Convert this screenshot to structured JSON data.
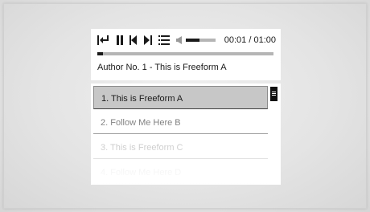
{
  "player": {
    "time_current": "00:01",
    "time_separator": " / ",
    "time_total": "01:00",
    "progress": 0.03,
    "volume": 0.45,
    "now_playing": "Author No. 1 - This is Freeform A",
    "controls": [
      {
        "name": "restart-icon"
      },
      {
        "name": "pause-icon"
      },
      {
        "name": "previous-track-icon"
      },
      {
        "name": "next-track-icon"
      },
      {
        "name": "playlist-icon"
      },
      {
        "name": "volume-icon"
      }
    ]
  },
  "playlist": {
    "items": [
      {
        "label": "1. This is Freeform A",
        "active": true
      },
      {
        "label": "2. Follow Me Here B",
        "active": false
      },
      {
        "label": "3. This is Freeform C",
        "active": false
      },
      {
        "label": "4. Follow Me Here D",
        "active": false
      }
    ]
  },
  "colors": {
    "background": "#e4e4e4",
    "panel": "#ffffff",
    "accent": "#1a1a1a",
    "track": "#b5b5b5",
    "active_row": "#c7c7c7"
  }
}
